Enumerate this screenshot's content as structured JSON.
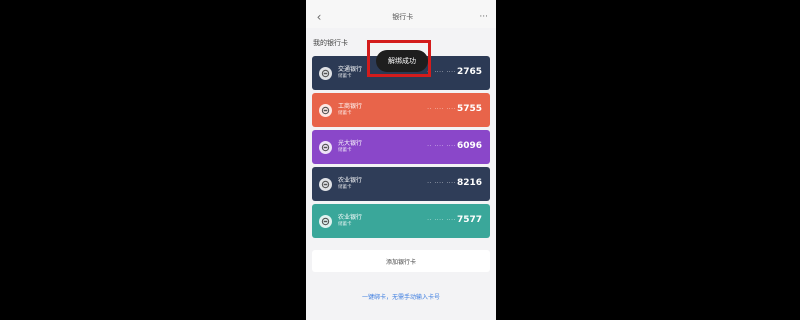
{
  "nav": {
    "title": "银行卡",
    "more_icon": "more-icon",
    "back_icon": "chevron-left-icon"
  },
  "section_title": "我的银行卡",
  "toast": {
    "text": "解绑成功"
  },
  "cards": [
    {
      "bank": "交通银行",
      "type": "储蓄卡",
      "masked": "·· ···· ····",
      "tail": "2765",
      "color": "#2c3a55"
    },
    {
      "bank": "工商银行",
      "type": "储蓄卡",
      "masked": "·· ···· ····",
      "tail": "5755",
      "color": "#e8644a"
    },
    {
      "bank": "光大银行",
      "type": "储蓄卡",
      "masked": "·· ···· ····",
      "tail": "6096",
      "color": "#8a47c9"
    },
    {
      "bank": "农业银行",
      "type": "储蓄卡",
      "masked": "·· ···· ····",
      "tail": "8216",
      "color": "#2f3d58"
    },
    {
      "bank": "农业银行",
      "type": "储蓄卡",
      "masked": "·· ···· ····",
      "tail": "7577",
      "color": "#3aa79a"
    }
  ],
  "add_button": "添加银行卡",
  "bottom_link": "一键绑卡，无需手动输入卡号"
}
